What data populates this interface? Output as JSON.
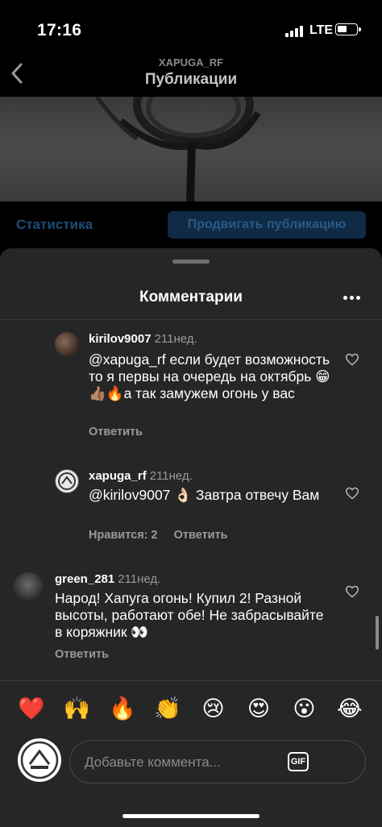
{
  "status": {
    "time": "17:16",
    "network": "LTE"
  },
  "header": {
    "username": "XAPUGA_RF",
    "title": "Публикации"
  },
  "post": {
    "stats_label": "Статистика",
    "promote_label": "Продвигать публикацию"
  },
  "sheet": {
    "title": "Комментарии"
  },
  "comments": [
    {
      "username": "kirilov9007",
      "time": "211нед.",
      "text": "@xapuga_rf если будет возможность то я первы на очередь на октябрь 😁👍🏽🔥а так замужем огонь у вас",
      "reply_label": "Ответить"
    },
    {
      "username": "xapuga_rf",
      "time": "211нед.",
      "text": "@kirilov9007 👌🏻 Завтра отвечу Вам",
      "likes_label": "Нравится: 2",
      "reply_label": "Ответить"
    },
    {
      "username": "green_281",
      "time": "211нед.",
      "text": "Народ! Хапуга огонь! Купил 2! Разной высоты, работают обе! Не забрасывайте в коряжник 👀",
      "reply_label": "Ответить"
    }
  ],
  "reactions": [
    "❤️",
    "🙌",
    "🔥",
    "👏",
    "😢",
    "😍",
    "😮",
    "😂"
  ],
  "composer": {
    "placeholder": "Добавьте коммента...",
    "gif_label": "GIF"
  },
  "colors": {
    "background": "#000000",
    "sheet": "#262626",
    "link": "#1f4c7a",
    "muted": "#9a9a9a"
  }
}
